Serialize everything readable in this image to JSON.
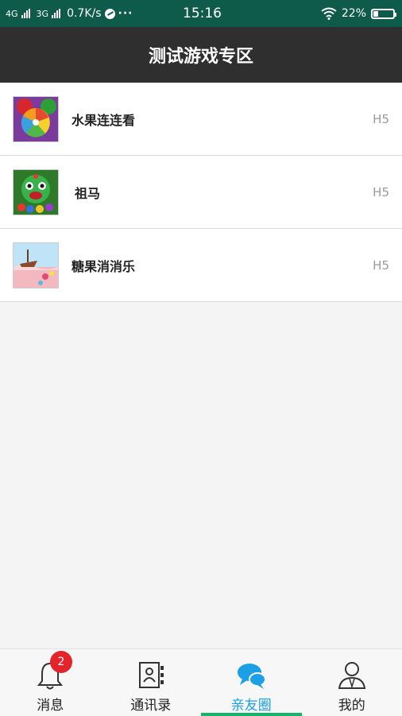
{
  "status_bar": {
    "network_1": "4G",
    "network_2": "3G",
    "speed": "0.7K/s",
    "time": "15:16",
    "battery": "22%",
    "battery_level": 0.22
  },
  "header": {
    "title": "测试游戏专区"
  },
  "games": [
    {
      "title": "水果连连看",
      "tag": "H5",
      "icon": "fruit-game-icon"
    },
    {
      "title": "祖马",
      "tag": "H5",
      "icon": "zuma-game-icon"
    },
    {
      "title": "糖果消消乐",
      "tag": "H5",
      "icon": "candy-game-icon"
    }
  ],
  "bottom_nav": {
    "items": [
      {
        "label": "消息",
        "badge": "2",
        "icon": "bell-icon"
      },
      {
        "label": "通讯录",
        "icon": "contacts-icon"
      },
      {
        "label": "亲友圈",
        "icon": "chat-bubbles-icon"
      },
      {
        "label": "我的",
        "icon": "user-icon"
      }
    ],
    "active_index": 2,
    "active_color": "#1ba0e6",
    "indicator_color": "#16b36b"
  }
}
